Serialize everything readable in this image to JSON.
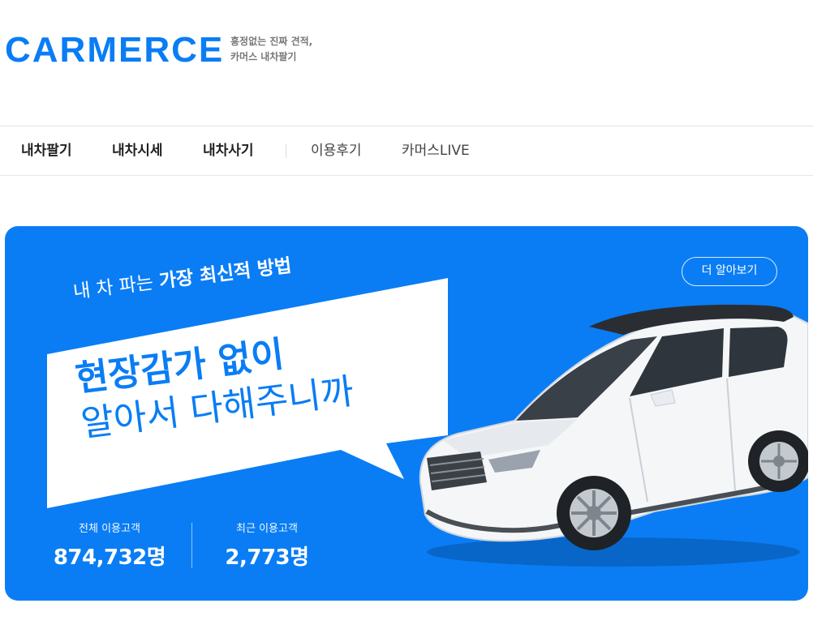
{
  "header": {
    "logo": "CARMERCE",
    "tagline_line1": "흥정없는 진짜 견적,",
    "tagline_line2": "카머스 내차팔기"
  },
  "nav": {
    "items": [
      {
        "label": "내차팔기"
      },
      {
        "label": "내차시세"
      },
      {
        "label": "내차사기"
      },
      {
        "label": "이용후기"
      },
      {
        "label": "카머스LIVE"
      }
    ]
  },
  "banner": {
    "more_button": "더 알아보기",
    "headline_prefix": "내 차 파는 ",
    "headline_bold": "가장 최신적 방법",
    "bubble_line1": "현장감가 없이",
    "bubble_line2": "알아서 다해주니까",
    "stats": [
      {
        "label": "전체 이용고객",
        "value": "874,732명"
      },
      {
        "label": "최근 이용고객",
        "value": "2,773명"
      }
    ],
    "colors": {
      "brand": "#0a7df5",
      "bubble": "#ffffff"
    }
  }
}
